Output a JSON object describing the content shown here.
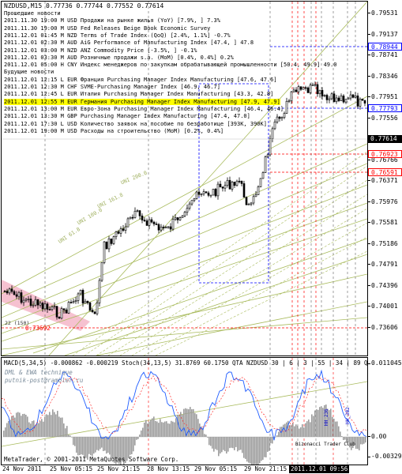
{
  "header": {
    "title": "NZDUSD,M15  0.77736 0.77744 0.77552 0.77614"
  },
  "news": {
    "past_title": "Прошедшие новости",
    "past": [
      "2011.11.30 19:00 M USD Продажи на рынке жилья (YoY) [7.9%, ] 7.3%",
      "2011.11.30 19:00 M USD Fed Releases Beige Book Economic Survey",
      "2011.12.01 01:45 M NZD Terms of Trade Index (QoQ) [2.4%, 1.1%] -0.7%",
      "2011.12.01 02:30 M AUD AiG Performance of Manufacturing Index [47.4, ] 47.8",
      "2011.12.01 03:00 M NZD ANZ Commodity Price [-3.5%, ] -0.1%",
      "2011.12.01 03:30 M AUD Розничные продажи s.a. (MoM) [0.4%, 0.4%] 0.2%",
      "2011.12.01 05:00 H CNY Индекс менеджеров по закупкам обрабатывающей промышленности [50.4, 49.9] 49.0"
    ],
    "future_title": "Будущие новости",
    "future": [
      "2011.12.01 12:15 L EUR Франция Purchasing Manager Index Manufacturing [47.6, 47.6]",
      "2011.12.01 12:30 M CHF SVME-Purchasing Manager Index [46.9, 46.7]",
      "2011.12.01 12:45 L EUR Италия Purchasing Manager Index Manufacturing [43.3, 42.8]",
      "2011.12.01 12:55 M EUR Германия Purchasing Manager Index Manufacturing [47.9, 47.9]",
      "2011.12.01 13:00 M EUR Евро-Зона Purchasing Manager Index Manufacturing [46.4, 46.4]",
      "2011.12.01 13:30 M GBP Purchasing Manager Index Manufacturing [47.4, 47.0]",
      "2011.12.01 17:30 L USD Количество заявок на пособие по безработице [393K, 390K]",
      "2011.12.01 19:00 M USD Расходы на строительство (MoM) [0.2%, 0.4%]"
    ]
  },
  "price_axis": {
    "ticks": [
      "0.79531",
      "0.79137",
      "0.78741",
      "0.78346",
      "0.77951",
      "0.77556",
      "0.77161",
      "0.76766",
      "0.76371",
      "0.75976",
      "0.75581",
      "0.75186",
      "0.74791",
      "0.74396",
      "0.74001",
      "0.73606"
    ],
    "tags": {
      "blue_top": "0.78944",
      "blue_mid": "0.77793",
      "current": "0.77614",
      "red_top": "0.76923",
      "red_bottom": "0.76591"
    }
  },
  "chart_labels": {
    "lvl_left": "0.73692",
    "lvl_small": "22 (150)",
    "fan": [
      "UNI 200.0",
      "UNI 161.8",
      "UNI 100.0",
      "UNI 61.8"
    ]
  },
  "indicator": {
    "header": "MACD(5,34,5) -0.000862 -0.000219 Stoch(34,13,5) 31.8769 60.1750  QTA NZDUSD 30 | 6 | 3 | 55 | 34 | 89 QTA NZDUSD 15",
    "watermark1": "DML & EWA technique",
    "watermark2": "putnik-post@rambler.ru",
    "ticks": [
      "0.011045",
      "0.00",
      "-0.003293"
    ],
    "vertical_labels": [
      "HH_236",
      "HH_382"
    ],
    "bottom_label": "Bizonacci Trader Club",
    "copyright": "MetaTrader, © 2001-2011 MetaQuotes Software Corp."
  },
  "time_axis": {
    "ticks": [
      "24 Nov 2011",
      "25 Nov 05:15",
      "25 Nov 21:15",
      "28 Nov 13:15",
      "29 Nov 05:15",
      "29 Nov 21:15",
      "30 Nov 13:15"
    ],
    "current": "2011.12.01 09:56"
  },
  "colors": {
    "candle": "#000000",
    "fan": "#a9bb5d",
    "blue_line": "#0000ff",
    "red_line": "#ff0000",
    "pink_channel": "#f4b6c8",
    "macd_hist": "#9c9c9c",
    "stoch_main": "#1f5cff",
    "stoch_signal": "#ff3030"
  }
}
